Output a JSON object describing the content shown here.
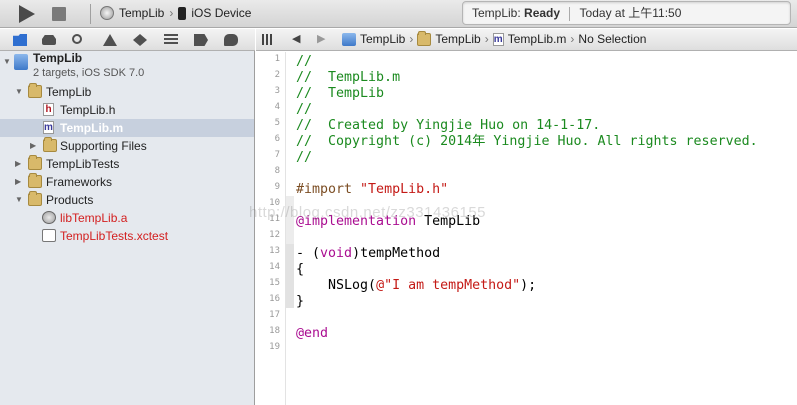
{
  "toolbar": {
    "scheme_target": "TempLib",
    "scheme_device": "iOS Device",
    "activity_project": "TempLib:",
    "activity_status": "Ready",
    "activity_time": "Today at 上午11:50"
  },
  "navigator": {
    "tabs": [
      "folder-icon",
      "hierarchy-icon",
      "search-icon",
      "warning-icon",
      "test-icon",
      "log-icon",
      "breakpoint-icon",
      "report-icon"
    ],
    "project_name": "TempLib",
    "project_subtitle": "2 targets, iOS SDK 7.0",
    "items": [
      {
        "label": "TempLib",
        "kind": "folder",
        "disclosure": "▼"
      },
      {
        "label": "TempLib.h",
        "kind": "h"
      },
      {
        "label": "TempLib.m",
        "kind": "m",
        "selected": true
      },
      {
        "label": "Supporting Files",
        "kind": "folder",
        "disclosure": "▶"
      },
      {
        "label": "TempLibTests",
        "kind": "folder",
        "disclosure": "▶"
      },
      {
        "label": "Frameworks",
        "kind": "folder",
        "disclosure": "▶"
      },
      {
        "label": "Products",
        "kind": "folder",
        "disclosure": "▼"
      },
      {
        "label": "libTempLib.a",
        "kind": "lib",
        "color": "#d31f1f"
      },
      {
        "label": "TempLibTests.xctest",
        "kind": "xctest",
        "color": "#d31f1f"
      }
    ]
  },
  "jumpbar": {
    "crumbs": [
      "TempLib",
      "TempLib",
      "TempLib.m",
      "No Selection"
    ]
  },
  "editor": {
    "line_numbers": [
      "1",
      "2",
      "3",
      "4",
      "5",
      "6",
      "7",
      "8",
      "9",
      "10",
      "11",
      "12",
      "13",
      "14",
      "15",
      "16",
      "17",
      "18",
      "19"
    ],
    "lines": [
      "//",
      "//  TempLib.m",
      "//  TempLib",
      "//",
      "//  Created by Yingjie Huo on 14-1-17.",
      "//  Copyright (c) 2014年 Yingjie Huo. All rights reserved.",
      "//",
      "",
      "#import ",
      "\"TempLib.h\"",
      "",
      "@implementation",
      " TempLib",
      "",
      "- (",
      "void",
      ")tempMethod",
      "{",
      "    NSLog(",
      "@\"I am tempMethod\"",
      ");",
      "}",
      "",
      "@end"
    ]
  },
  "watermark": "http://blog.csdn.net/zz331436155",
  "colors": {
    "comment": "#1b8a1f",
    "keyword": "#aa0d91",
    "string": "#c41a16",
    "preprocessor": "#7c4e24",
    "selection": "#c7d0de"
  }
}
